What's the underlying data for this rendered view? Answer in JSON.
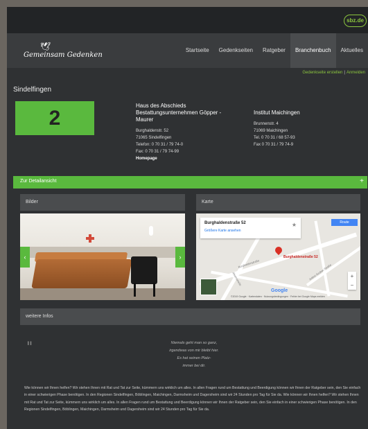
{
  "brand": {
    "site_badge": "sbz.de",
    "logo_text": "Gemeinsam Gedenken"
  },
  "nav": {
    "items": [
      "Startseite",
      "Gedenkseiten",
      "Ratgeber",
      "Branchenbuch",
      "Aktuelles"
    ],
    "active_index": 3
  },
  "sublinks": {
    "create": "Gedenkseite erstellen",
    "separator": "|",
    "login": "Anmelden"
  },
  "page": {
    "city": "Sindelfingen",
    "rank": "2"
  },
  "listing": {
    "name_line1": "Haus des Abschieds",
    "name_line2": "Bestattungsunternehmen Göpper -",
    "name_line3": "Maurer",
    "street": "Burghaldenstr. 52",
    "zip_city": "71065 Sindelfingen",
    "phone": "Telefon: 0 70 31 / 79 74-0",
    "fax": "Fax: 0 70 31 / 79 74-99",
    "homepage": "Homepage"
  },
  "second_listing": {
    "name": "Institut Maichingen",
    "street": "Brunnenstr. 4",
    "zip_city": "71069 Maichingen",
    "phone": "Tel. 0 70 31 / 68 57-93",
    "fax": "Fax 0 70 31 / 79 74-9"
  },
  "detail": {
    "label": "Zur Detailansicht",
    "toggle": "+"
  },
  "panels": {
    "images": "Bilder",
    "map": "Karte",
    "more": "weitere Infos"
  },
  "map": {
    "card_title": "Burghaldenstraße 52",
    "card_link": "Größere Karte ansehen",
    "directions": "Route",
    "pin_label": "Burghaldenstraße 52",
    "street1": "Burghaldenstraße",
    "street2": "Arthur-Gruber-Straße",
    "street3": "Ahornstraße",
    "provider": "Google",
    "footer": "©2019 Google · Kartendaten · Nutzungsbedingungen · Fehler bei Google Maps melden",
    "zoom_in": "+",
    "zoom_out": "−"
  },
  "quote": {
    "mark": "\"",
    "line1": "Niemals geht man so ganz,",
    "line2": "irgendwas von mir bleibt hier.",
    "line3": "Es hat seinen Platz-",
    "line4": "immer bei dir."
  },
  "body_text": "Wie können wir Ihnen helfen? Wir stehen Ihnen mit Rat und Tat zur Seite, kümmern uns wirklich um alles. In allen Fragen rund um Bestattung und Beerdigung können wir Ihnen der Ratgeber sein, den Sie einfach in einer schwierigen Phase benötigen. In den Regionen Sindelfingen, Böblingen, Maichingen, Darmsheim und Dagersheim sind wir 24 Stunden pro Tag für Sie da. Wie können wir Ihnen helfen? Wir stehen Ihnen mit Rat und Tat zur Seite, kümmern uns wirklich um alles. In allen Fragen rund um Bestattung und Beerdigung können wir Ihnen der Ratgeber sein, den Sie einfach in einer schwierigen Phase benötigen. In den Regionen Sindelfingen, Böblingen, Maichingen, Darmsheim und Dagersheim sind wir 24 Stunden pro Tag für Sie da.",
  "colors": {
    "accent": "#5ab93e",
    "background": "#2f3133",
    "panel": "#4a4c4e"
  },
  "icons": {
    "prev": "chevron-left-icon",
    "next": "chevron-right-icon",
    "dove": "dove-icon",
    "star": "star-icon"
  }
}
